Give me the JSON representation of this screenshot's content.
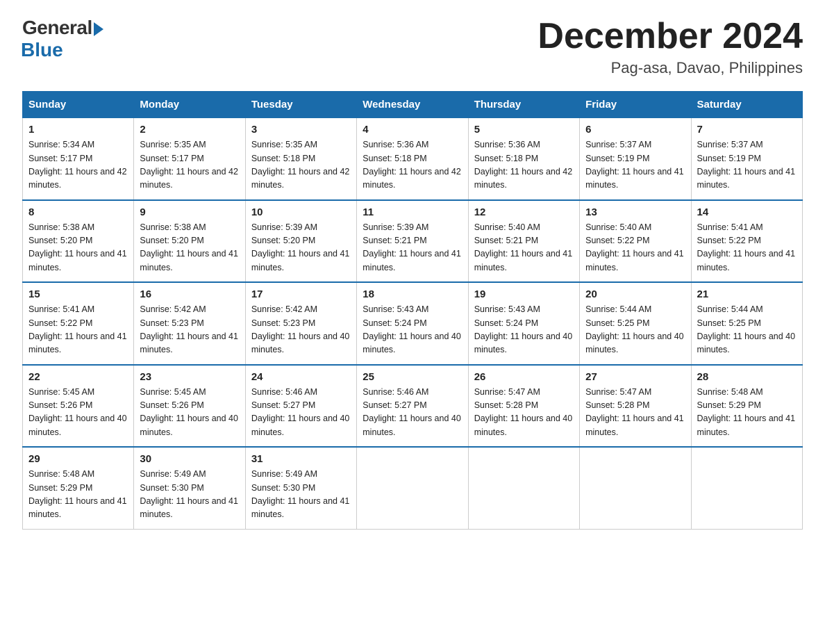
{
  "header": {
    "logo_general": "General",
    "logo_blue": "Blue",
    "month_title": "December 2024",
    "location": "Pag-asa, Davao, Philippines"
  },
  "days_of_week": [
    "Sunday",
    "Monday",
    "Tuesday",
    "Wednesday",
    "Thursday",
    "Friday",
    "Saturday"
  ],
  "weeks": [
    [
      {
        "day": "1",
        "sunrise": "5:34 AM",
        "sunset": "5:17 PM",
        "daylight": "11 hours and 42 minutes."
      },
      {
        "day": "2",
        "sunrise": "5:35 AM",
        "sunset": "5:17 PM",
        "daylight": "11 hours and 42 minutes."
      },
      {
        "day": "3",
        "sunrise": "5:35 AM",
        "sunset": "5:18 PM",
        "daylight": "11 hours and 42 minutes."
      },
      {
        "day": "4",
        "sunrise": "5:36 AM",
        "sunset": "5:18 PM",
        "daylight": "11 hours and 42 minutes."
      },
      {
        "day": "5",
        "sunrise": "5:36 AM",
        "sunset": "5:18 PM",
        "daylight": "11 hours and 42 minutes."
      },
      {
        "day": "6",
        "sunrise": "5:37 AM",
        "sunset": "5:19 PM",
        "daylight": "11 hours and 41 minutes."
      },
      {
        "day": "7",
        "sunrise": "5:37 AM",
        "sunset": "5:19 PM",
        "daylight": "11 hours and 41 minutes."
      }
    ],
    [
      {
        "day": "8",
        "sunrise": "5:38 AM",
        "sunset": "5:20 PM",
        "daylight": "11 hours and 41 minutes."
      },
      {
        "day": "9",
        "sunrise": "5:38 AM",
        "sunset": "5:20 PM",
        "daylight": "11 hours and 41 minutes."
      },
      {
        "day": "10",
        "sunrise": "5:39 AM",
        "sunset": "5:20 PM",
        "daylight": "11 hours and 41 minutes."
      },
      {
        "day": "11",
        "sunrise": "5:39 AM",
        "sunset": "5:21 PM",
        "daylight": "11 hours and 41 minutes."
      },
      {
        "day": "12",
        "sunrise": "5:40 AM",
        "sunset": "5:21 PM",
        "daylight": "11 hours and 41 minutes."
      },
      {
        "day": "13",
        "sunrise": "5:40 AM",
        "sunset": "5:22 PM",
        "daylight": "11 hours and 41 minutes."
      },
      {
        "day": "14",
        "sunrise": "5:41 AM",
        "sunset": "5:22 PM",
        "daylight": "11 hours and 41 minutes."
      }
    ],
    [
      {
        "day": "15",
        "sunrise": "5:41 AM",
        "sunset": "5:22 PM",
        "daylight": "11 hours and 41 minutes."
      },
      {
        "day": "16",
        "sunrise": "5:42 AM",
        "sunset": "5:23 PM",
        "daylight": "11 hours and 41 minutes."
      },
      {
        "day": "17",
        "sunrise": "5:42 AM",
        "sunset": "5:23 PM",
        "daylight": "11 hours and 40 minutes."
      },
      {
        "day": "18",
        "sunrise": "5:43 AM",
        "sunset": "5:24 PM",
        "daylight": "11 hours and 40 minutes."
      },
      {
        "day": "19",
        "sunrise": "5:43 AM",
        "sunset": "5:24 PM",
        "daylight": "11 hours and 40 minutes."
      },
      {
        "day": "20",
        "sunrise": "5:44 AM",
        "sunset": "5:25 PM",
        "daylight": "11 hours and 40 minutes."
      },
      {
        "day": "21",
        "sunrise": "5:44 AM",
        "sunset": "5:25 PM",
        "daylight": "11 hours and 40 minutes."
      }
    ],
    [
      {
        "day": "22",
        "sunrise": "5:45 AM",
        "sunset": "5:26 PM",
        "daylight": "11 hours and 40 minutes."
      },
      {
        "day": "23",
        "sunrise": "5:45 AM",
        "sunset": "5:26 PM",
        "daylight": "11 hours and 40 minutes."
      },
      {
        "day": "24",
        "sunrise": "5:46 AM",
        "sunset": "5:27 PM",
        "daylight": "11 hours and 40 minutes."
      },
      {
        "day": "25",
        "sunrise": "5:46 AM",
        "sunset": "5:27 PM",
        "daylight": "11 hours and 40 minutes."
      },
      {
        "day": "26",
        "sunrise": "5:47 AM",
        "sunset": "5:28 PM",
        "daylight": "11 hours and 40 minutes."
      },
      {
        "day": "27",
        "sunrise": "5:47 AM",
        "sunset": "5:28 PM",
        "daylight": "11 hours and 41 minutes."
      },
      {
        "day": "28",
        "sunrise": "5:48 AM",
        "sunset": "5:29 PM",
        "daylight": "11 hours and 41 minutes."
      }
    ],
    [
      {
        "day": "29",
        "sunrise": "5:48 AM",
        "sunset": "5:29 PM",
        "daylight": "11 hours and 41 minutes."
      },
      {
        "day": "30",
        "sunrise": "5:49 AM",
        "sunset": "5:30 PM",
        "daylight": "11 hours and 41 minutes."
      },
      {
        "day": "31",
        "sunrise": "5:49 AM",
        "sunset": "5:30 PM",
        "daylight": "11 hours and 41 minutes."
      },
      null,
      null,
      null,
      null
    ]
  ],
  "labels": {
    "sunrise": "Sunrise:",
    "sunset": "Sunset:",
    "daylight": "Daylight:"
  }
}
